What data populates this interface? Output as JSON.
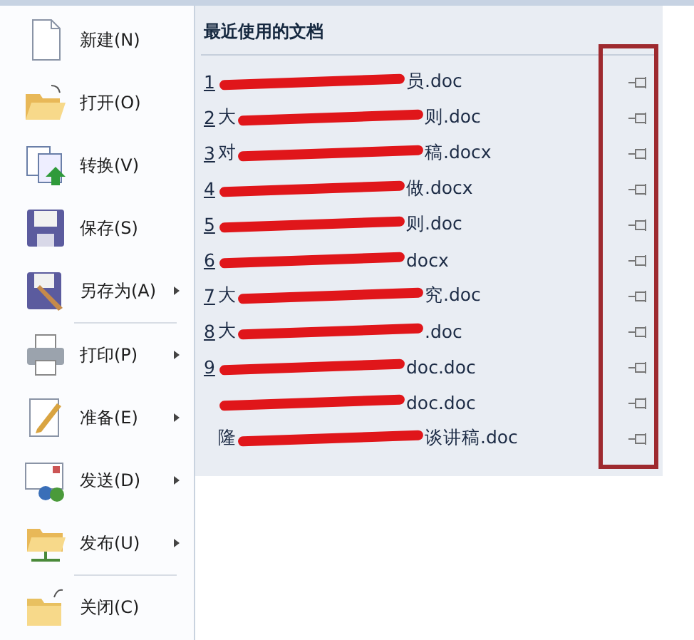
{
  "menu": [
    {
      "kind": "new",
      "label": "新建(N)",
      "submenu": false
    },
    {
      "kind": "open",
      "label": "打开(O)",
      "submenu": false
    },
    {
      "kind": "convert",
      "label": "转换(V)",
      "submenu": false
    },
    {
      "kind": "save",
      "label": "保存(S)",
      "submenu": false
    },
    {
      "kind": "saveas",
      "label": "另存为(A)",
      "submenu": true,
      "separator_after": true
    },
    {
      "kind": "print",
      "label": "打印(P)",
      "submenu": true
    },
    {
      "kind": "prepare",
      "label": "准备(E)",
      "submenu": true
    },
    {
      "kind": "send",
      "label": "发送(D)",
      "submenu": true
    },
    {
      "kind": "publish",
      "label": "发布(U)",
      "submenu": true,
      "separator_after": true
    },
    {
      "kind": "close",
      "label": "关闭(C)",
      "submenu": false
    }
  ],
  "recent": {
    "title": "最近使用的文档",
    "files": [
      {
        "number": "1",
        "after": "员.doc"
      },
      {
        "number": "2",
        "before": "大",
        "after": "则.doc"
      },
      {
        "number": "3",
        "before": "对",
        "after": "稿.docx"
      },
      {
        "number": "4",
        "after": "做.docx"
      },
      {
        "number": "5",
        "after": "则.doc"
      },
      {
        "number": "6",
        "after": "docx"
      },
      {
        "number": "7",
        "before": "大",
        "after": "究.doc"
      },
      {
        "number": "8",
        "before": "大",
        "after": ".doc"
      },
      {
        "number": "9",
        "after": "doc.doc"
      },
      {
        "after": "doc.doc"
      },
      {
        "before": "隆",
        "after": "谈讲稿.doc"
      }
    ]
  }
}
